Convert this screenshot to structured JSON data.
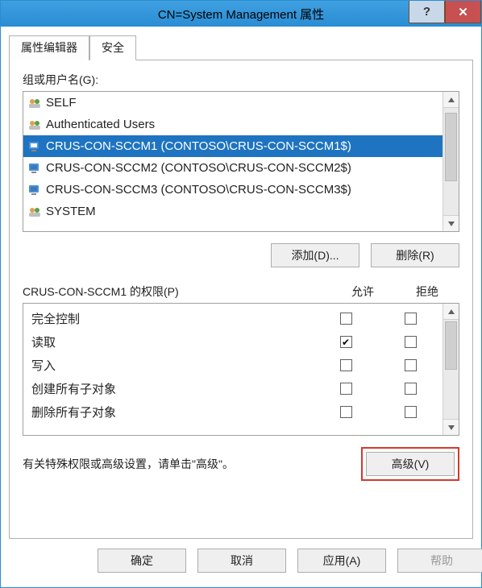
{
  "window": {
    "title": "CN=System Management 属性"
  },
  "tabs": {
    "editor": "属性编辑器",
    "security": "安全"
  },
  "groups": {
    "label": "组或用户名(G):",
    "items": [
      {
        "name": "SELF",
        "icon": "group"
      },
      {
        "name": "Authenticated Users",
        "icon": "group"
      },
      {
        "name": "CRUS-CON-SCCM1 (CONTOSO\\CRUS-CON-SCCM1$)",
        "icon": "computer",
        "selected": true
      },
      {
        "name": "CRUS-CON-SCCM2 (CONTOSO\\CRUS-CON-SCCM2$)",
        "icon": "computer"
      },
      {
        "name": "CRUS-CON-SCCM3 (CONTOSO\\CRUS-CON-SCCM3$)",
        "icon": "computer"
      },
      {
        "name": "SYSTEM",
        "icon": "group"
      }
    ]
  },
  "buttons": {
    "add": "添加(D)...",
    "remove": "删除(R)",
    "advanced": "高级(V)",
    "ok": "确定",
    "cancel": "取消",
    "apply": "应用(A)",
    "help": "帮助"
  },
  "permissions": {
    "label": "CRUS-CON-SCCM1 的权限(P)",
    "allow_header": "允许",
    "deny_header": "拒绝",
    "rows": [
      {
        "name": "完全控制",
        "allow": false,
        "deny": false
      },
      {
        "name": "读取",
        "allow": true,
        "deny": false
      },
      {
        "name": "写入",
        "allow": false,
        "deny": false
      },
      {
        "name": "创建所有子对象",
        "allow": false,
        "deny": false
      },
      {
        "name": "删除所有子对象",
        "allow": false,
        "deny": false
      }
    ]
  },
  "advanced_text": "有关特殊权限或高级设置，请单击\"高级\"。"
}
